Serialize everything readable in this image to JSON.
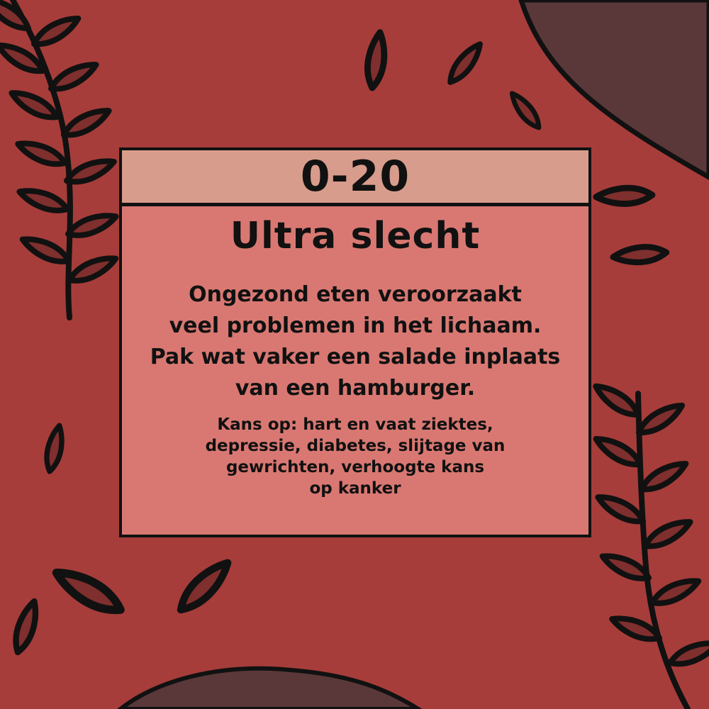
{
  "card": {
    "score_range": "0-20",
    "title": "Ultra slecht",
    "message_lines": [
      "Ongezond eten veroorzaakt",
      "veel problemen in het lichaam.",
      "Pak wat vaker een salade inplaats",
      "van een hamburger."
    ],
    "risk_lines": [
      "Kans op: hart en vaat ziektes,",
      "depressie, diabetes, slijtage van",
      "gewrichten, verhoogte kans",
      "op kanker"
    ]
  },
  "colors": {
    "background": "#a63d3a",
    "header": "#d89c8c",
    "card": "#d97872",
    "leaf_fill": "#7f2f2d",
    "blob": "#5a383a",
    "stroke": "#111111"
  },
  "icons": [
    "leaf-branch-left-icon",
    "leaf-branch-right-icon",
    "falling-leaf-icon",
    "background-blob-icon"
  ]
}
